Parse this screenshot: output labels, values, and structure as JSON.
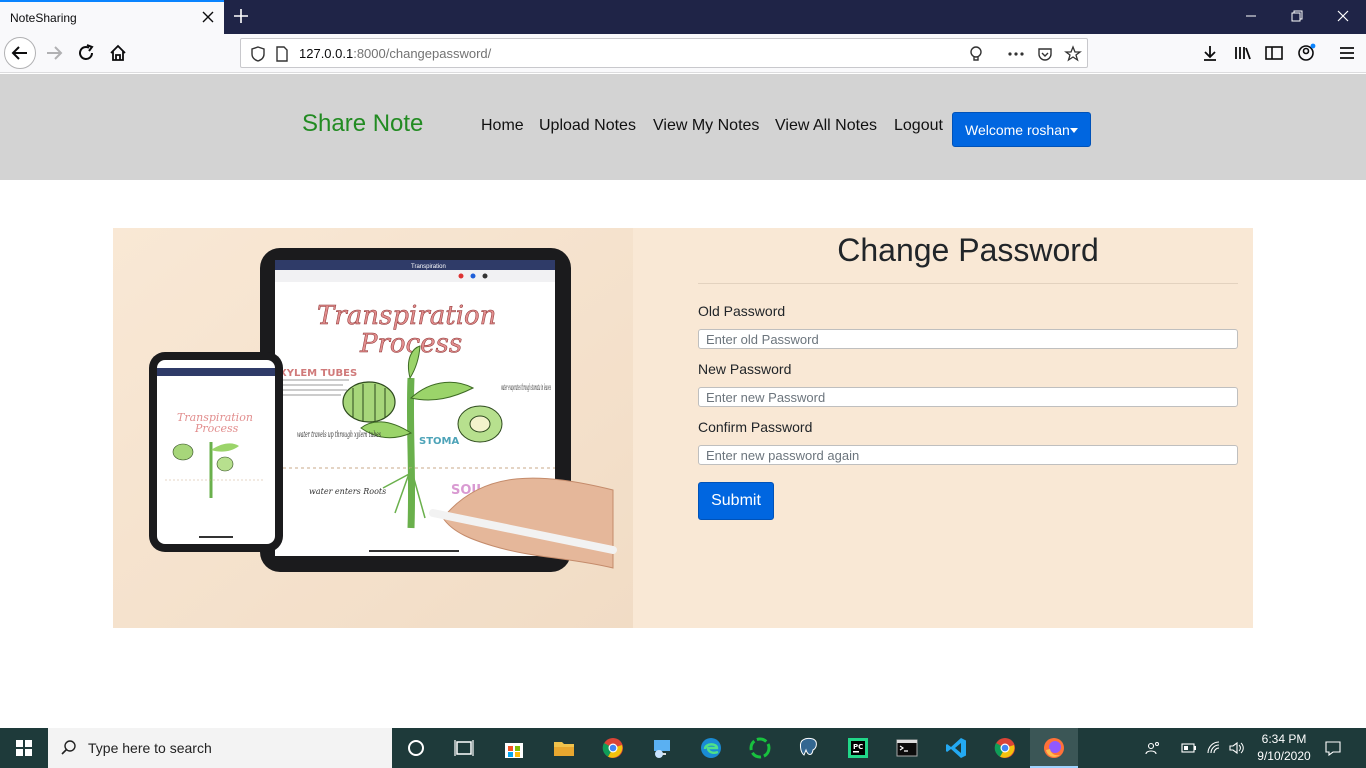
{
  "browser": {
    "tab_title": "NoteSharing",
    "url_host": "127.0.0.1",
    "url_rest": ":8000/changepassword/"
  },
  "site": {
    "brand": "Share Note",
    "nav": [
      "Home",
      "Upload Notes",
      "View My Notes",
      "View All Notes",
      "Logout"
    ],
    "welcome_label": "Welcome roshan"
  },
  "form": {
    "title": "Change Password",
    "old_label": "Old Password",
    "old_placeholder": "Enter old Password",
    "new_label": "New Password",
    "new_placeholder": "Enter new Password",
    "confirm_label": "Confirm Password",
    "confirm_placeholder": "Enter new password again",
    "submit_label": "Submit"
  },
  "illustration": {
    "tablet_heading_line1": "Transpiration",
    "tablet_heading_line2": "Process",
    "tablet_toolbar_title": "Transpiration",
    "phone_heading_line1": "Transpiration",
    "phone_heading_line2": "Process",
    "labels": [
      "XYLEM TUBES",
      "STOMA",
      "water evaporates through stomata in leaves",
      "water travels up through xylem tubes",
      "water enters Roots",
      "SOIL"
    ]
  },
  "taskbar": {
    "search_placeholder": "Type here to search",
    "time": "6:34 PM",
    "date": "9/10/2020"
  },
  "colors": {
    "brand": "#228b22",
    "accent_button": "#0066e0",
    "panel_bg": "#f9e8d5",
    "header_bg": "#d3d3d3"
  }
}
